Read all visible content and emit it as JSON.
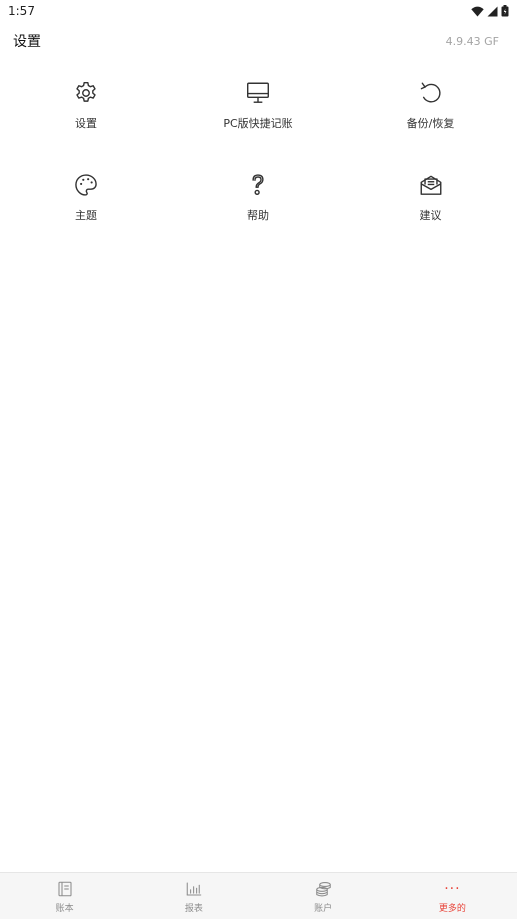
{
  "status_bar": {
    "time": "1:57",
    "icons": [
      "wifi-icon",
      "signal-icon",
      "battery-icon"
    ]
  },
  "header": {
    "title": "设置",
    "version": "4.9.43 GF"
  },
  "grid": {
    "items": [
      {
        "label": "设置",
        "icon": "gear-icon"
      },
      {
        "label": "PC版快捷记账",
        "icon": "monitor-icon"
      },
      {
        "label": "备份/恢复",
        "icon": "restore-icon"
      },
      {
        "label": "主题",
        "icon": "palette-icon"
      },
      {
        "label": "帮助",
        "icon": "help-icon"
      },
      {
        "label": "建议",
        "icon": "mail-suggest-icon"
      }
    ]
  },
  "tabbar": {
    "tabs": [
      {
        "label": "账本",
        "icon": "book-icon",
        "active": false
      },
      {
        "label": "报表",
        "icon": "bar-chart-icon",
        "active": false
      },
      {
        "label": "账户",
        "icon": "coins-icon",
        "active": false
      },
      {
        "label": "更多的",
        "icon": "more-dots-icon",
        "active": true
      }
    ],
    "more_glyph": "···"
  },
  "colors": {
    "accent": "#e8443a",
    "inactive_tab": "#8c8c8c",
    "icon_stroke": "#333333",
    "version_text": "#a4a4a4"
  }
}
